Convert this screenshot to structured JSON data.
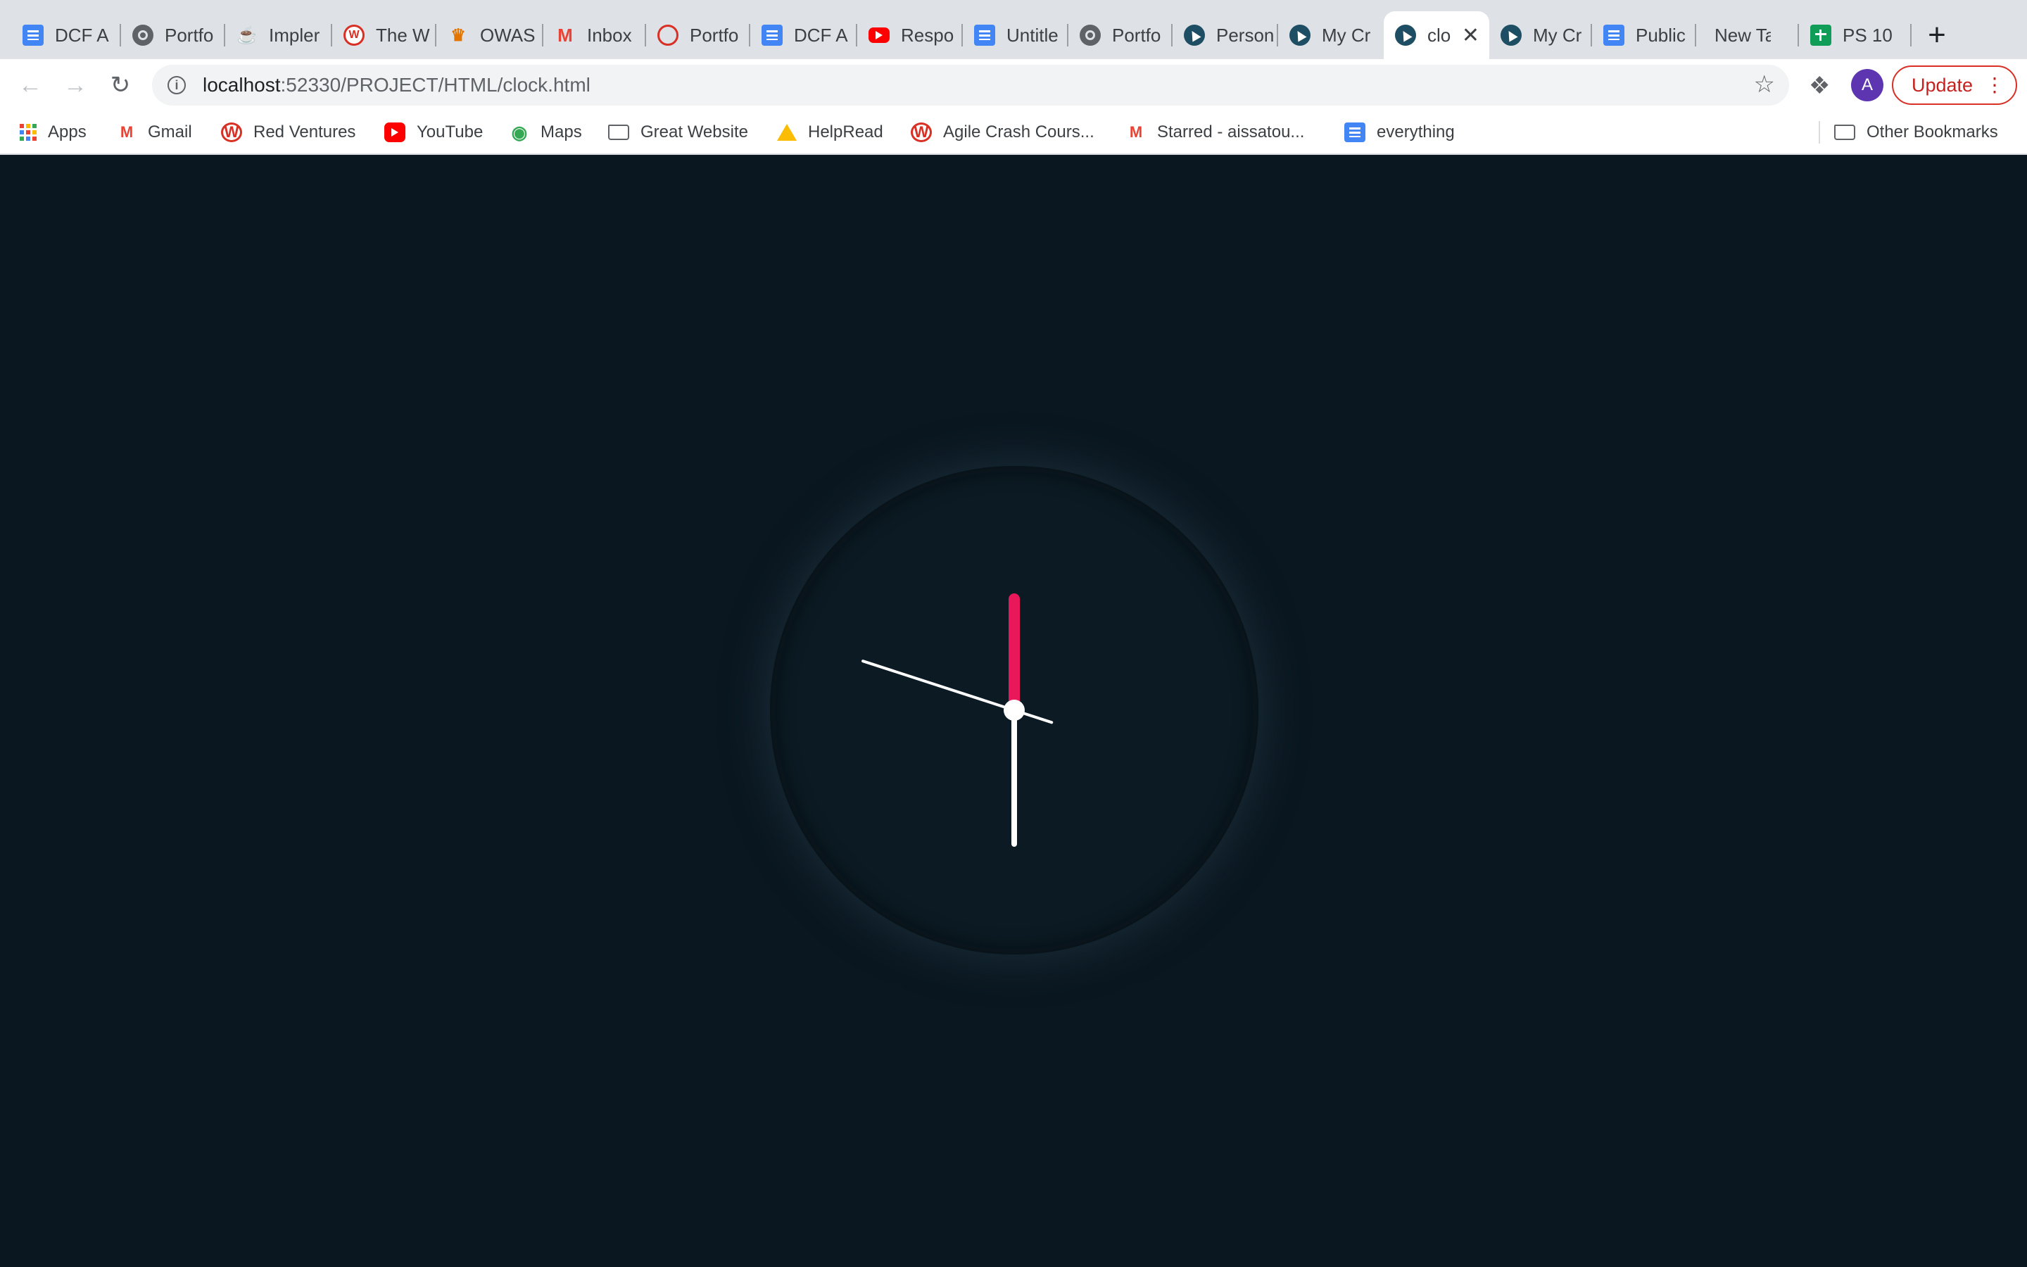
{
  "tabs": [
    {
      "label": "DCF A",
      "icon": "google-docs-icon",
      "kind": "doc"
    },
    {
      "label": "Portfo",
      "icon": "globe-icon",
      "kind": "globe"
    },
    {
      "label": "Impler",
      "icon": "coffee-cup-icon",
      "kind": "cup"
    },
    {
      "label": "The W",
      "icon": "wordpress-icon",
      "kind": "wp"
    },
    {
      "label": "OWAS",
      "icon": "owasp-icon",
      "kind": "owasp"
    },
    {
      "label": "Inbox",
      "icon": "gmail-icon",
      "kind": "gmail"
    },
    {
      "label": "Portfo",
      "icon": "wheel-icon",
      "kind": "wheel"
    },
    {
      "label": "DCF A",
      "icon": "google-docs-icon",
      "kind": "doc"
    },
    {
      "label": "Respo",
      "icon": "youtube-icon",
      "kind": "yt"
    },
    {
      "label": "Untitle",
      "icon": "google-docs-icon",
      "kind": "doc"
    },
    {
      "label": "Portfo",
      "icon": "globe-icon",
      "kind": "globe"
    },
    {
      "label": "Person",
      "icon": "cursor-icon",
      "kind": "cursor"
    },
    {
      "label": "My Cr",
      "icon": "cursor-icon",
      "kind": "cursor"
    },
    {
      "label": "clo",
      "icon": "cursor-icon",
      "kind": "cursor",
      "active": true
    },
    {
      "label": "My Cr",
      "icon": "cursor-icon",
      "kind": "cursor"
    },
    {
      "label": "Public",
      "icon": "google-docs-icon",
      "kind": "doc"
    },
    {
      "label": "New Tab",
      "icon": "",
      "kind": "none"
    },
    {
      "label": "PS 10",
      "icon": "google-sheets-icon",
      "kind": "sheet"
    }
  ],
  "toolbar": {
    "url_host": "localhost",
    "url_rest": ":52330/PROJECT/HTML/clock.html",
    "avatar_letter": "A",
    "update_label": "Update"
  },
  "bookmarks": [
    {
      "label": "Apps",
      "icon": "apps-grid-icon"
    },
    {
      "label": "Gmail",
      "icon": "gmail-icon"
    },
    {
      "label": "Red Ventures",
      "icon": "wordpress-icon"
    },
    {
      "label": "YouTube",
      "icon": "youtube-icon"
    },
    {
      "label": "Maps",
      "icon": "maps-pin-icon"
    },
    {
      "label": "Great Website",
      "icon": "folder-icon"
    },
    {
      "label": "HelpRead",
      "icon": "drive-icon"
    },
    {
      "label": "Agile Crash Cours...",
      "icon": "wordpress-icon"
    },
    {
      "label": "Starred - aissatou...",
      "icon": "gmail-icon"
    },
    {
      "label": "everything",
      "icon": "google-docs-icon"
    }
  ],
  "other_bookmarks": "Other Bookmarks",
  "clock": {
    "time": {
      "hour": 12,
      "minute": 30,
      "second": 48
    },
    "colors": {
      "background": "#0a1720",
      "face": "#0b1a23",
      "hour_hand": "#e8185a",
      "minute_hand": "#ffffff",
      "second_hand": "#ffffff",
      "center_dot": "#ffffff"
    }
  }
}
